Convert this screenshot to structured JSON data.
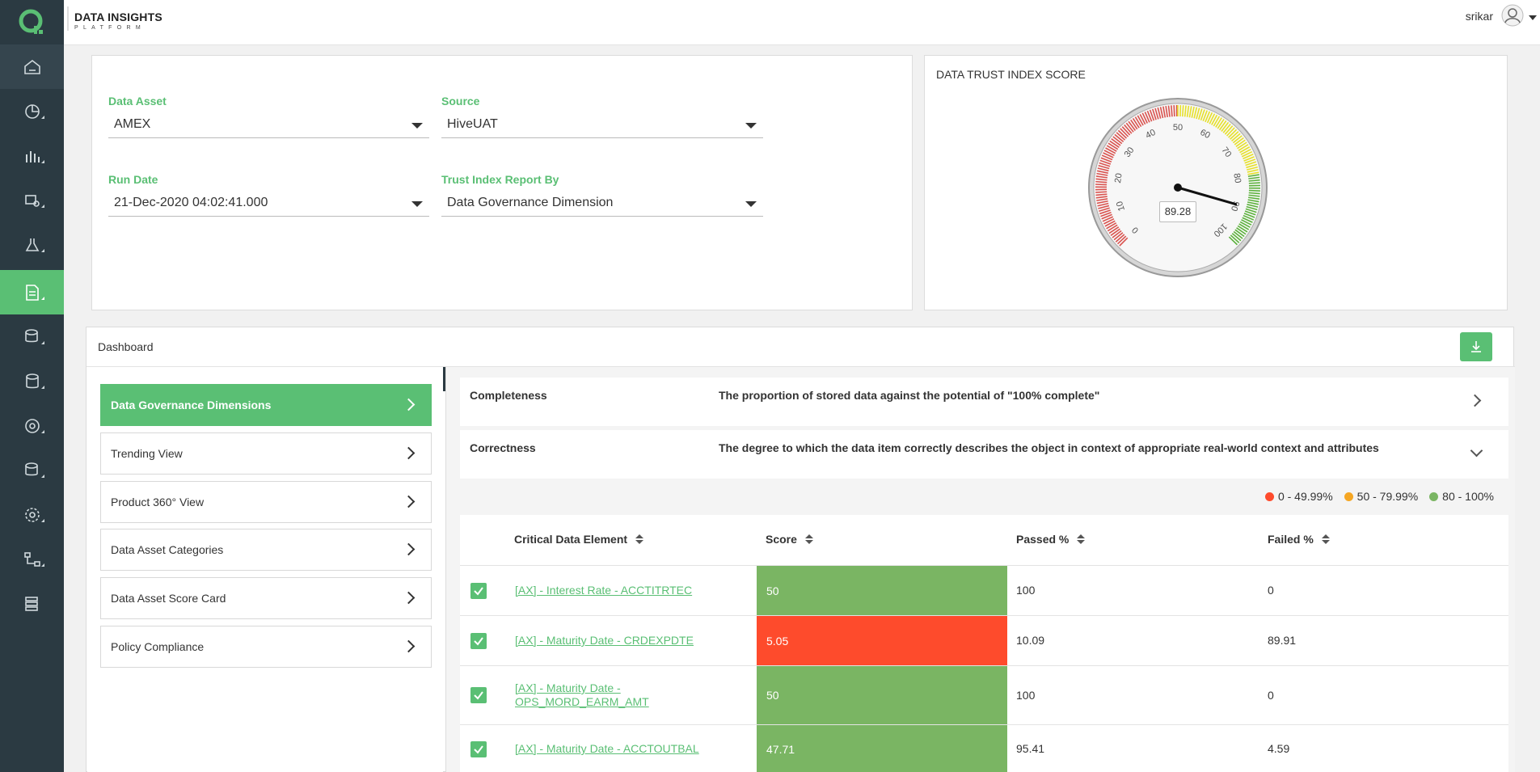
{
  "app": {
    "brand": "DATA INSIGHTS",
    "brand_sub": "PLATFORM",
    "user": "srikar"
  },
  "sidebar": {
    "items": [
      {
        "icon": "home-icon"
      },
      {
        "icon": "pie-chart-icon"
      },
      {
        "icon": "bar-chart-icon"
      },
      {
        "icon": "data-settings-icon"
      },
      {
        "icon": "lab-icon"
      },
      {
        "icon": "report-icon"
      },
      {
        "icon": "database-cloud-icon"
      },
      {
        "icon": "database-icon"
      },
      {
        "icon": "target-icon"
      },
      {
        "icon": "database-sync-icon"
      },
      {
        "icon": "gear-icon"
      },
      {
        "icon": "workflow-icon"
      },
      {
        "icon": "list-icon"
      }
    ]
  },
  "filters": {
    "data_asset": {
      "label": "Data Asset",
      "value": "AMEX"
    },
    "source": {
      "label": "Source",
      "value": "HiveUAT"
    },
    "run_date": {
      "label": "Run Date",
      "value": "21-Dec-2020 04:02:41.000"
    },
    "report_by": {
      "label": "Trust Index Report By",
      "value": "Data Governance Dimension"
    }
  },
  "gauge": {
    "title": "DATA TRUST INDEX SCORE",
    "value": 89.28,
    "value_label": "89.28",
    "min": 0,
    "max": 100,
    "ticks": [
      "0",
      "10",
      "20",
      "30",
      "40",
      "50",
      "60",
      "70",
      "80",
      "90",
      "100"
    ],
    "bands": [
      {
        "from": 0,
        "to": 50,
        "color": "#d9534f"
      },
      {
        "from": 50,
        "to": 80,
        "color": "#e6e02a"
      },
      {
        "from": 80,
        "to": 100,
        "color": "#5cb13c"
      }
    ]
  },
  "dashboard": {
    "title": "Dashboard",
    "menu": [
      {
        "label": "Data Governance Dimensions",
        "active": true
      },
      {
        "label": "Trending View",
        "active": false
      },
      {
        "label": "Product 360° View",
        "active": false
      },
      {
        "label": "Data Asset Categories",
        "active": false
      },
      {
        "label": "Data Asset Score Card",
        "active": false
      },
      {
        "label": "Policy Compliance",
        "active": false
      }
    ],
    "dimensions": [
      {
        "name": "Completeness",
        "desc": "The proportion of stored data against the potential of \"100% complete\""
      },
      {
        "name": "Correctness",
        "desc": "The degree to which the data item correctly describes the object in context of appropriate real-world context and attributes"
      }
    ],
    "legend": [
      {
        "label": "0 - 49.99%",
        "color": "#fe4b2c"
      },
      {
        "label": "50 - 79.99%",
        "color": "#f5a623"
      },
      {
        "label": "80 - 100%",
        "color": "#7ab563"
      }
    ],
    "table": {
      "headers": [
        "Critical Data Element",
        "Score",
        "Passed %",
        "Failed %"
      ],
      "rows": [
        {
          "cde": "[AX] - Interest Rate - ACCTITRTEC",
          "score": "50",
          "passed": "100",
          "failed": "0",
          "status": "green"
        },
        {
          "cde": "[AX] - Maturity Date - CRDEXPDTE",
          "score": "5.05",
          "passed": "10.09",
          "failed": "89.91",
          "status": "red"
        },
        {
          "cde": "[AX] - Maturity Date - OPS_MORD_EARM_AMT",
          "score": "50",
          "passed": "100",
          "failed": "0",
          "status": "green"
        },
        {
          "cde": "[AX] - Maturity Date - ACCTOUTBAL",
          "score": "47.71",
          "passed": "95.41",
          "failed": "4.59",
          "status": "green"
        }
      ]
    }
  }
}
